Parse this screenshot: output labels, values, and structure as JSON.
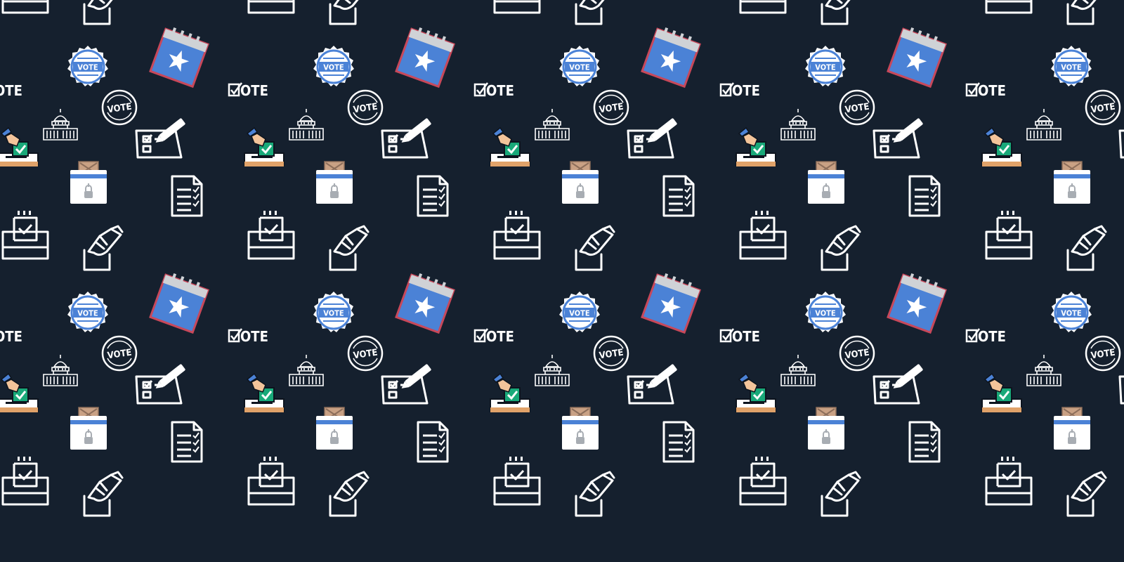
{
  "pattern": {
    "background": "#15202e",
    "repeat_columns": 5,
    "repeat_rows": 3,
    "vote_word": "VOTE",
    "icons": [
      "ballot-box-outline-icon",
      "hand-voting-icon",
      "vote-seal-badge-icon",
      "calendar-star-icon",
      "checkbox-vote-wordmark-icon",
      "vote-stamp-circle-icon",
      "capitol-building-icon",
      "ballot-form-pen-icon",
      "hand-casting-ballot-icon",
      "locked-ballot-box-icon",
      "checklist-document-icon"
    ]
  },
  "colors": {
    "line": "#ffffff",
    "blue": "#4b82d6",
    "red": "#c8485a",
    "green": "#19a979",
    "tan": "#c9a184",
    "orange": "#e0a269",
    "skin": "#f3c49a",
    "gray": "#cfd2d6",
    "lock": "#a8adb3"
  }
}
